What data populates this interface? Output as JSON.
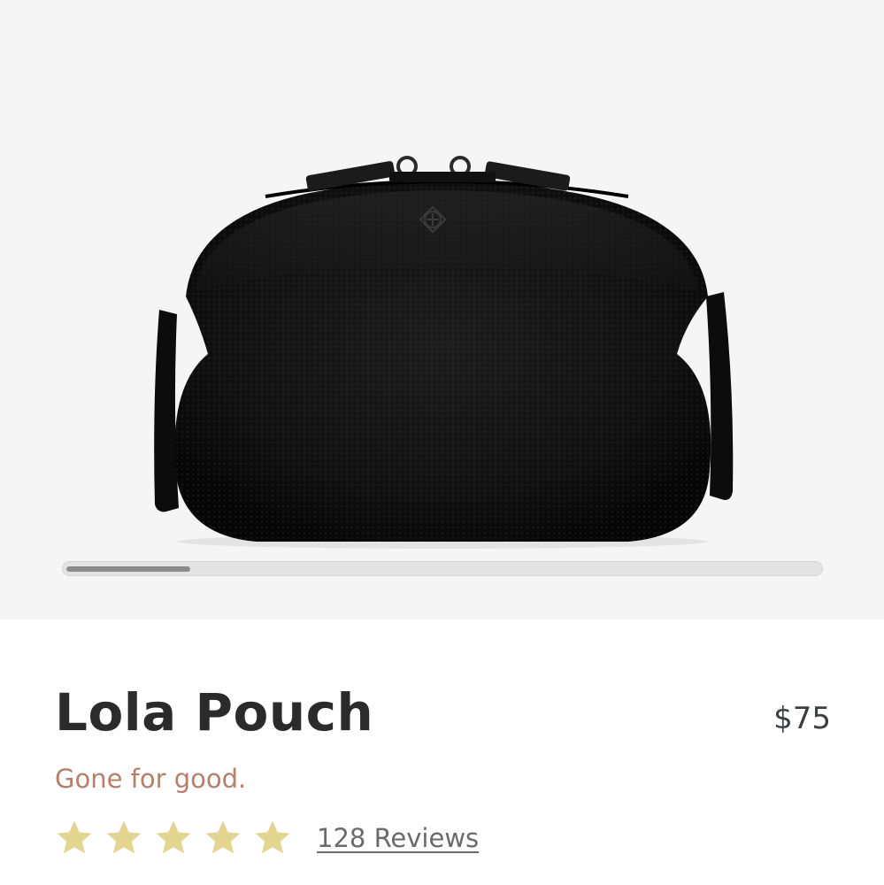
{
  "product": {
    "name": "Lola Pouch",
    "price": "$75",
    "tagline": "Gone for good.",
    "rating": {
      "stars": 5,
      "max_stars": 5,
      "reviews_label": "128 Reviews"
    },
    "image": {
      "alt": "Lola Pouch",
      "subject": "black pebbled leather pouch"
    }
  },
  "gallery": {
    "scroll_progress": 0.165
  },
  "colors": {
    "gallery_background": "#f5f5f5",
    "title": "#2b2b2b",
    "price": "#3a3f42",
    "tagline": "#b4806c",
    "star": "#e3d48f",
    "reviews_link": "#6a6a6a"
  },
  "icons": {
    "star": "star-icon"
  }
}
